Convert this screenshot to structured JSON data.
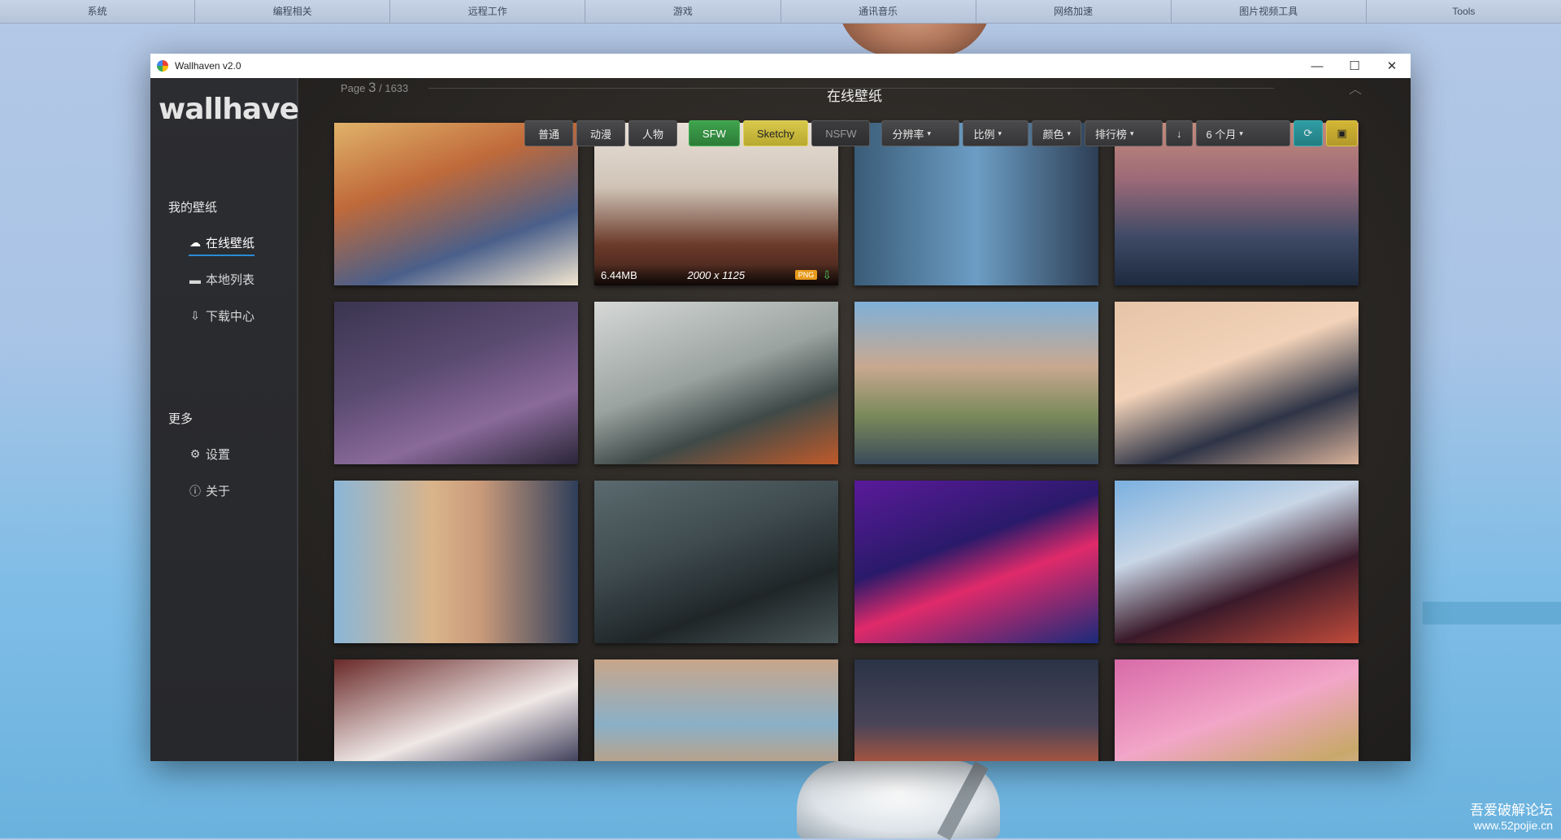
{
  "topbar": {
    "items": [
      "系统",
      "编程相关",
      "远程工作",
      "游戏",
      "通讯音乐",
      "网络加速",
      "图片视频工具",
      "Tools"
    ]
  },
  "window": {
    "title": "Wallhaven v2.0",
    "controls": {
      "minimize": "—",
      "maximize": "☐",
      "close": "✕"
    }
  },
  "sidebar": {
    "logo": "wallhaven",
    "section_mine": "我的壁纸",
    "items": [
      {
        "label": "在线壁纸",
        "icon": "cloud-icon",
        "glyph": "☁"
      },
      {
        "label": "本地列表",
        "icon": "folder-icon",
        "glyph": "▬"
      },
      {
        "label": "下载中心",
        "icon": "download-icon",
        "glyph": "⇩"
      }
    ],
    "section_more": "更多",
    "more_items": [
      {
        "label": "设置",
        "icon": "gear-icon",
        "glyph": "⚙"
      },
      {
        "label": "关于",
        "icon": "info-icon",
        "glyph": "ⓘ"
      }
    ]
  },
  "content": {
    "title": "在线壁纸",
    "page_label": "Page",
    "page_current": "3",
    "page_sep": "/",
    "page_total": "1633",
    "up_glyph": "︿"
  },
  "toolbar": {
    "categories": [
      "普通",
      "动漫",
      "人物"
    ],
    "purity": {
      "sfw": "SFW",
      "sketchy": "Sketchy",
      "nsfw": "NSFW"
    },
    "resolution": "分辨率",
    "ratio": "比例",
    "color": "颜色",
    "sort": "排行榜",
    "order_glyph": "↓",
    "range": "6 个月",
    "caret": "▾",
    "refresh_glyph": "⟳",
    "save_glyph": "▣"
  },
  "thumbnail": {
    "size": "6.44MB",
    "resolution": "2000 x 1125",
    "format": "PNG",
    "download_glyph": "⇩"
  },
  "watermark": {
    "cn": "吾爱破解论坛",
    "url": "www.52pojie.cn"
  },
  "colors": {
    "accent": "#2a8ad4",
    "sfw": "#3fa34d",
    "sketchy": "#d8c84a",
    "refresh": "#2f9da4"
  }
}
